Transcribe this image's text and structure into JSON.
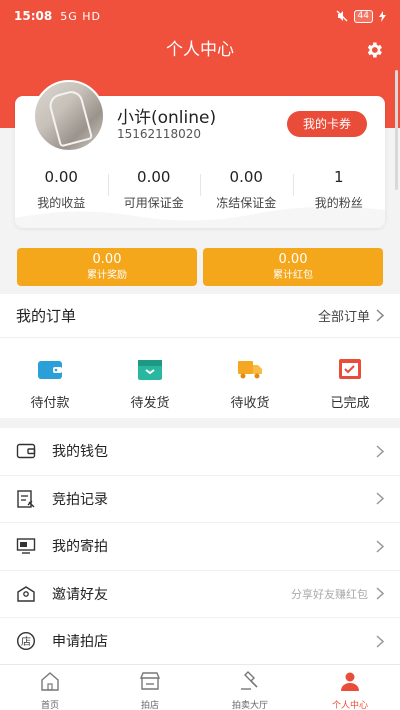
{
  "status": {
    "time": "15:08",
    "signal": "5G HD",
    "battery": "44"
  },
  "header": {
    "title": "个人中心"
  },
  "profile": {
    "name": "小许(online)",
    "phone": "15162118020",
    "coupon_button": "我的卡券",
    "stats": [
      {
        "value": "0.00",
        "label": "我的收益"
      },
      {
        "value": "0.00",
        "label": "可用保证金"
      },
      {
        "value": "0.00",
        "label": "冻结保证金"
      },
      {
        "value": "1",
        "label": "我的粉丝"
      }
    ]
  },
  "rewards": [
    {
      "value": "0.00",
      "label": "累计奖励"
    },
    {
      "value": "0.00",
      "label": "累计红包"
    }
  ],
  "orders": {
    "title": "我的订单",
    "all_label": "全部订单",
    "items": [
      {
        "label": "待付款",
        "icon": "wallet-icon",
        "color": "#2a9fd8"
      },
      {
        "label": "待发货",
        "icon": "package-icon",
        "color": "#2ab7a0"
      },
      {
        "label": "待收货",
        "icon": "truck-icon",
        "color": "#f5a623"
      },
      {
        "label": "已完成",
        "icon": "check-box-icon",
        "color": "#ea4c3a"
      }
    ]
  },
  "menu": [
    {
      "label": "我的钱包",
      "icon": "wallet-outline-icon",
      "hint": ""
    },
    {
      "label": "竞拍记录",
      "icon": "record-icon",
      "hint": ""
    },
    {
      "label": "我的寄拍",
      "icon": "consign-icon",
      "hint": ""
    },
    {
      "label": "邀请好友",
      "icon": "invite-icon",
      "hint": "分享好友赚红包"
    },
    {
      "label": "申请拍店",
      "icon": "shop-icon",
      "hint": ""
    }
  ],
  "tabbar": [
    {
      "label": "首页",
      "icon": "home-icon",
      "active": false
    },
    {
      "label": "拍店",
      "icon": "store-icon",
      "active": false
    },
    {
      "label": "拍卖大厅",
      "icon": "gavel-icon",
      "active": false
    },
    {
      "label": "个人中心",
      "icon": "person-icon",
      "active": true
    }
  ],
  "colors": {
    "primary": "#f0513c",
    "accent": "#ea4c3a",
    "gold": "#f5a71b"
  }
}
